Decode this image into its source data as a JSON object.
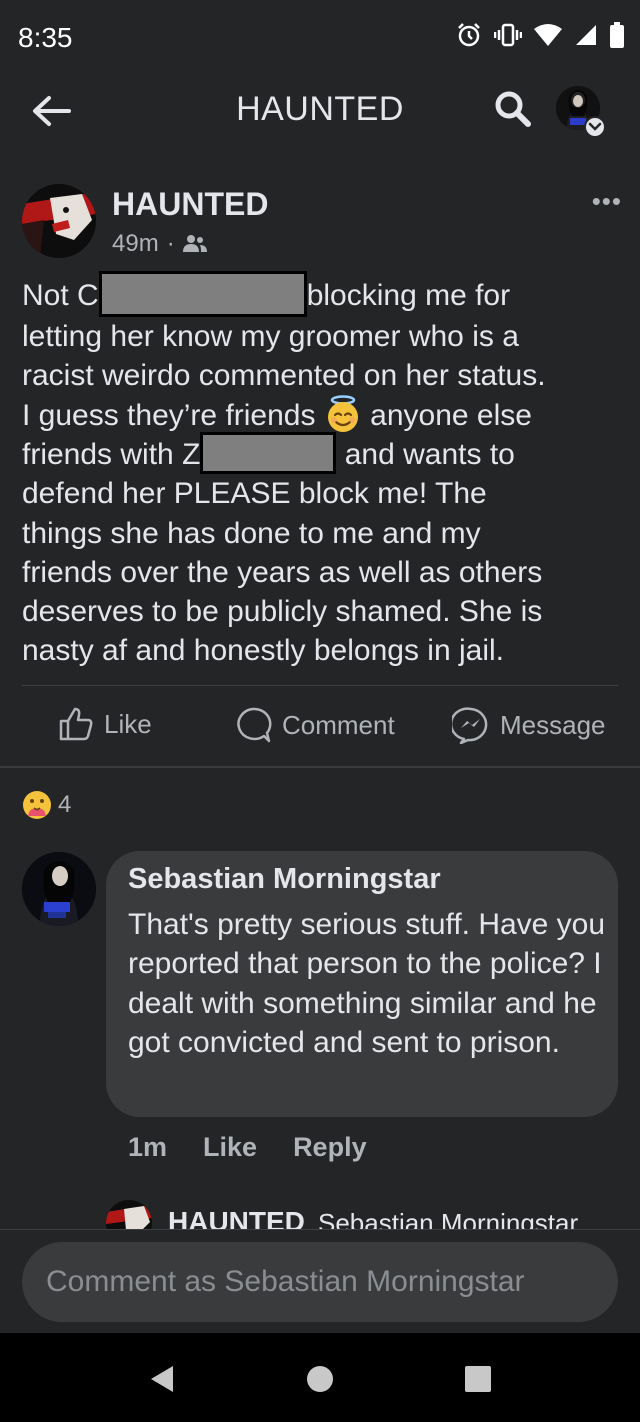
{
  "status_bar": {
    "time": "8:35"
  },
  "header": {
    "title": "HAUNTED"
  },
  "post": {
    "author": "HAUNTED",
    "time": "49m",
    "separator": "·",
    "more": "•••",
    "lines": {
      "l1_a": "Not C",
      "l1_b": "blocking me for",
      "l2": "letting her know my groomer who is a",
      "l3": "racist weirdo commented on her status.",
      "l4_a": "I guess they’re friends",
      "l4_b": "anyone else",
      "l5_a": "friends with Z",
      "l5_b": "and wants to",
      "l6": "defend her PLEASE block me! The",
      "l7": "things she has done to me and my",
      "l8": "friends over the years as well as others",
      "l9": "deserves to be publicly shamed. She is",
      "l10": "nasty af and honestly belongs in jail."
    }
  },
  "actions": {
    "like": "Like",
    "comment": "Comment",
    "message": "Message"
  },
  "reactions": {
    "count": "4"
  },
  "comment": {
    "author": "Sebastian Morningstar",
    "text": "That's pretty serious stuff. Have you reported that person to the police? I dealt with something similar and he got convicted and sent to prison.",
    "time": "1m",
    "like": "Like",
    "reply": "Reply"
  },
  "reply_peek": {
    "author": "HAUNTED",
    "target": "Sebastian Morningstar"
  },
  "composer": {
    "placeholder": "Comment as Sebastian Morningstar"
  },
  "colors": {
    "background": "#242527",
    "bubble": "#3a3b3c",
    "text": "#e4e6eb",
    "muted": "#b0b3b8"
  }
}
